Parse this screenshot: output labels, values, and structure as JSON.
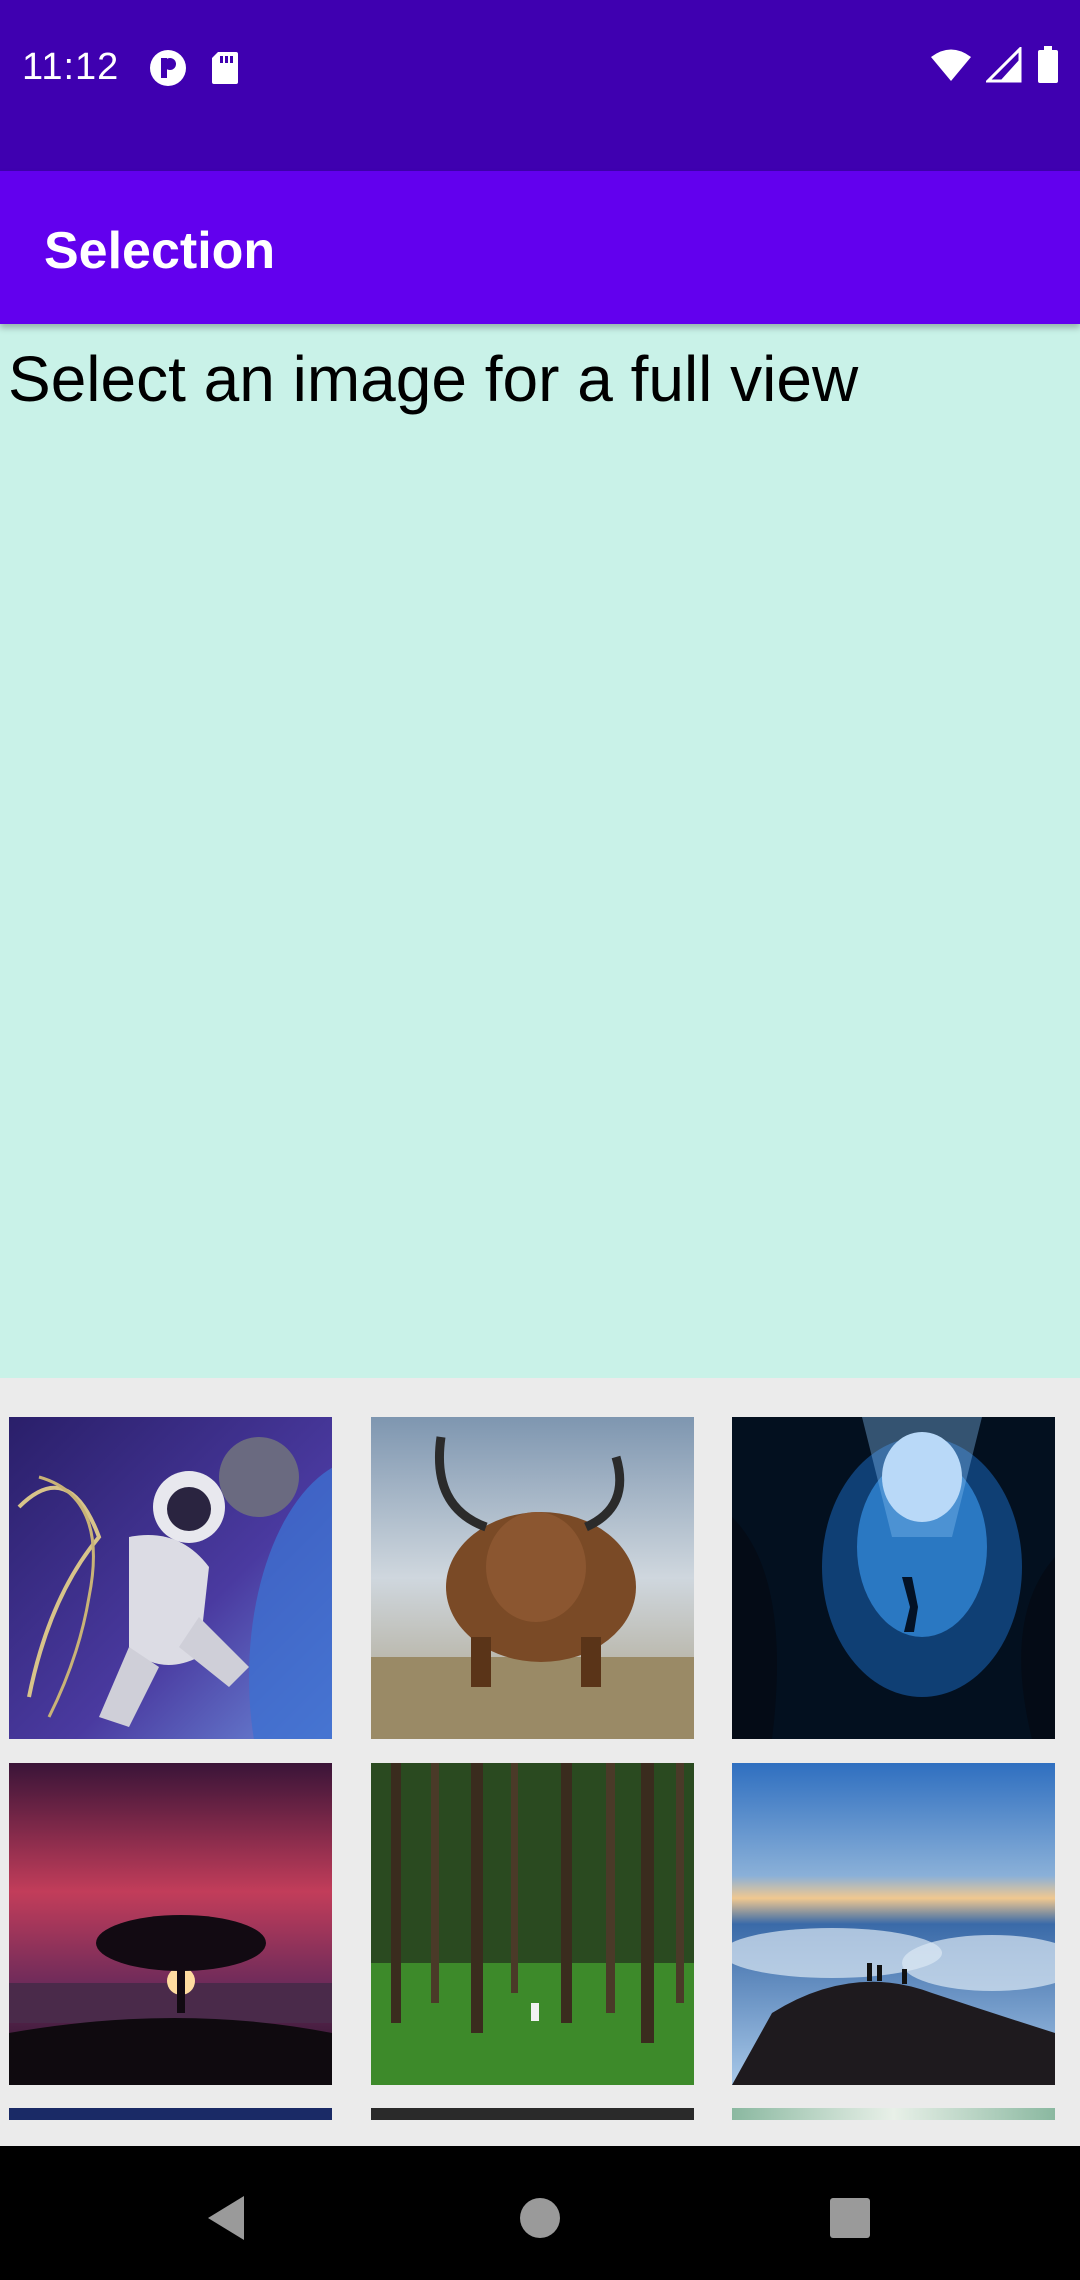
{
  "status_bar": {
    "time": "11:12",
    "left_icons": [
      "app-notification-icon",
      "sd-card-icon"
    ],
    "right_icons": [
      "wifi-icon",
      "cellular-signal-icon",
      "battery-icon"
    ]
  },
  "app_bar": {
    "title": "Selection"
  },
  "preview": {
    "prompt": "Select an image for a full view"
  },
  "gallery": {
    "images": [
      {
        "subject": "astronaut-spacewalk"
      },
      {
        "subject": "highland-cattle"
      },
      {
        "subject": "underwater-cave-diver"
      },
      {
        "subject": "tree-sunset"
      },
      {
        "subject": "green-forest"
      },
      {
        "subject": "mountain-above-clouds"
      },
      {
        "subject": "partial-image-7"
      },
      {
        "subject": "partial-image-8"
      },
      {
        "subject": "partial-image-9"
      }
    ]
  },
  "nav_bar": {
    "buttons": [
      "back-icon",
      "home-icon",
      "recents-icon"
    ]
  },
  "colors": {
    "status_bar": "#3F00B0",
    "app_bar": "#6200EE",
    "preview_bg": "#C9F2E8",
    "gallery_bg": "#EBEBEB"
  }
}
